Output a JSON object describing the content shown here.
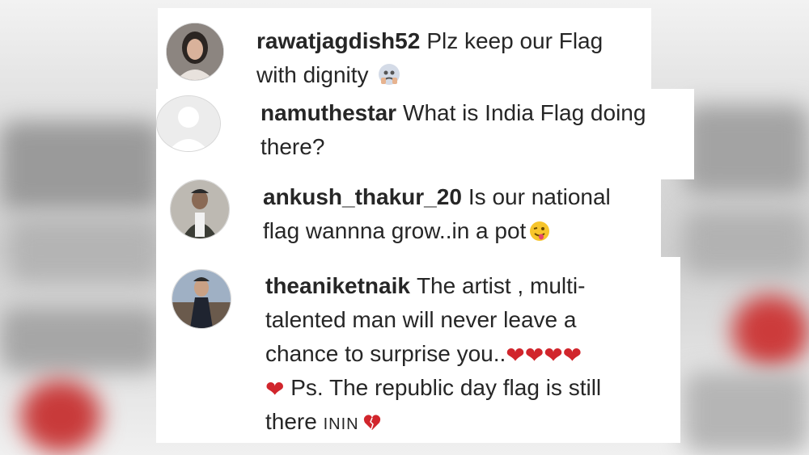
{
  "comments": [
    {
      "username": "rawatjagdish52",
      "text": "Plz keep our Flag with dignity",
      "emoji": "pleading-face"
    },
    {
      "username": "namuthestar",
      "text": "What is India Flag doing there?"
    },
    {
      "username": "ankush_thakur_20",
      "text": "Is our national flag wannna grow..in a pot",
      "emoji": "winking-tongue-face"
    },
    {
      "username": "theaniketnaik",
      "text": "The artist , multi-talented man will never leave a chance to surprise you..",
      "text_ps": "Ps. The republic day flag is still there",
      "text_tail": "ININ",
      "emoji": "red-hearts"
    }
  ],
  "colors": {
    "text": "#262626",
    "heart": "#d1252c",
    "background": "#e9e9e9",
    "card": "#ffffff"
  }
}
